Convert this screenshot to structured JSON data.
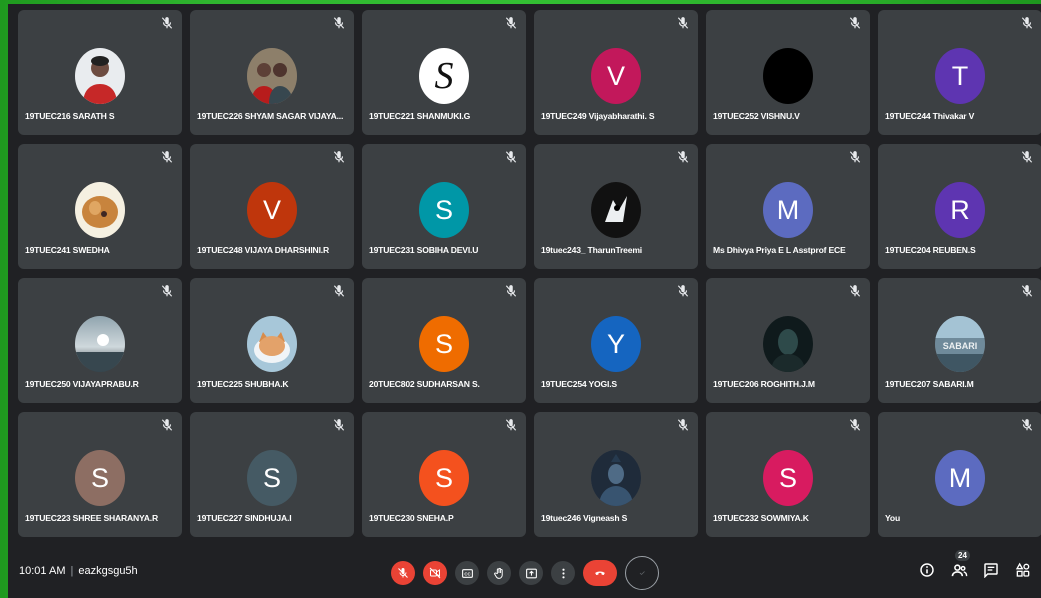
{
  "participants": [
    {
      "name": "19TUEC216 SARATH S",
      "avatar": {
        "type": "photo",
        "theme": "person-red"
      }
    },
    {
      "name": "19TUEC226 SHYAM SAGAR VIJAYA...",
      "avatar": {
        "type": "photo",
        "theme": "person-group"
      }
    },
    {
      "name": "19TUEC221 SHANMUKI.G",
      "avatar": {
        "type": "logo",
        "letter": "S",
        "color": "#ffffff"
      }
    },
    {
      "name": "19TUEC249 Vijayabharathi. S",
      "avatar": {
        "type": "letter",
        "letter": "V",
        "color": "#c2185b"
      }
    },
    {
      "name": "19TUEC252 VISHNU.V",
      "avatar": {
        "type": "plain",
        "color": "#000000"
      }
    },
    {
      "name": "19TUEC244 Thivakar V",
      "avatar": {
        "type": "letter",
        "letter": "T",
        "color": "#5e35b1"
      }
    },
    {
      "name": "19TUEC241 SWEDHA",
      "avatar": {
        "type": "photo",
        "theme": "dog"
      }
    },
    {
      "name": "19TUEC248 VIJAYA DHARSHINI.R",
      "avatar": {
        "type": "letter",
        "letter": "V",
        "color": "#bf360c"
      }
    },
    {
      "name": "19TUEC231 SOBIHA DEVI.U",
      "avatar": {
        "type": "letter",
        "letter": "S",
        "color": "#0097a7"
      }
    },
    {
      "name": "19tuec243_ TharunTreemi",
      "avatar": {
        "type": "photo",
        "theme": "cartoon"
      }
    },
    {
      "name": "Ms Dhivya Priya E L Asstprof ECE",
      "avatar": {
        "type": "letter",
        "letter": "M",
        "color": "#5c6bc0"
      }
    },
    {
      "name": "19TUEC204 REUBEN.S",
      "avatar": {
        "type": "letter",
        "letter": "R",
        "color": "#5e35b1"
      }
    },
    {
      "name": "19TUEC250 VIJAYAPRABU.R",
      "avatar": {
        "type": "photo",
        "theme": "sunset"
      }
    },
    {
      "name": "19TUEC225 SHUBHA.K",
      "avatar": {
        "type": "photo",
        "theme": "cat"
      }
    },
    {
      "name": "20TUEC802 SUDHARSAN S.",
      "avatar": {
        "type": "letter",
        "letter": "S",
        "color": "#ef6c00"
      }
    },
    {
      "name": "19TUEC254 YOGI.S",
      "avatar": {
        "type": "letter",
        "letter": "Y",
        "color": "#1565c0"
      }
    },
    {
      "name": "19TUEC206 ROGHITH.J.M",
      "avatar": {
        "type": "photo",
        "theme": "dark-portrait"
      }
    },
    {
      "name": "19TUEC207 SABARI.M",
      "avatar": {
        "type": "photo",
        "theme": "sabari-logo",
        "text": "SABARI"
      }
    },
    {
      "name": "19TUEC223 SHREE SHARANYA.R",
      "avatar": {
        "type": "letter",
        "letter": "S",
        "color": "#8d6e63"
      }
    },
    {
      "name": "19TUEC227 SINDHUJA.I",
      "avatar": {
        "type": "letter",
        "letter": "S",
        "color": "#455a64"
      }
    },
    {
      "name": "19TUEC230 SNEHA.P",
      "avatar": {
        "type": "letter",
        "letter": "S",
        "color": "#f4511e"
      }
    },
    {
      "name": "19tuec246 Vigneash S",
      "avatar": {
        "type": "photo",
        "theme": "deity"
      }
    },
    {
      "name": "19TUEC232 SOWMIYA.K",
      "avatar": {
        "type": "letter",
        "letter": "S",
        "color": "#d81b60"
      }
    },
    {
      "name": "You",
      "avatar": {
        "type": "letter",
        "letter": "M",
        "color": "#5c6bc0"
      }
    }
  ],
  "bottom_bar": {
    "time": "10:01 AM",
    "separator": "|",
    "meeting_code": "eazkgsgu5h",
    "people_count": "24"
  },
  "controls": [
    {
      "name": "mic-off-button",
      "icon": "mic-off-icon",
      "style": "red"
    },
    {
      "name": "camera-off-button",
      "icon": "camera-off-icon",
      "style": "red"
    },
    {
      "name": "captions-button",
      "icon": "captions-icon",
      "style": "dark"
    },
    {
      "name": "raise-hand-button",
      "icon": "hand-icon",
      "style": "dark"
    },
    {
      "name": "present-button",
      "icon": "present-icon",
      "style": "dark"
    },
    {
      "name": "more-options-button",
      "icon": "more-vert-icon",
      "style": "dark"
    },
    {
      "name": "leave-call-button",
      "icon": "end-call-icon",
      "style": "end"
    },
    {
      "name": "extension-button",
      "icon": "check-icon",
      "style": "ring"
    }
  ],
  "colors": {
    "tile_bg": "#3c4043",
    "page_bg": "#202124",
    "accent_red": "#ea4335"
  }
}
